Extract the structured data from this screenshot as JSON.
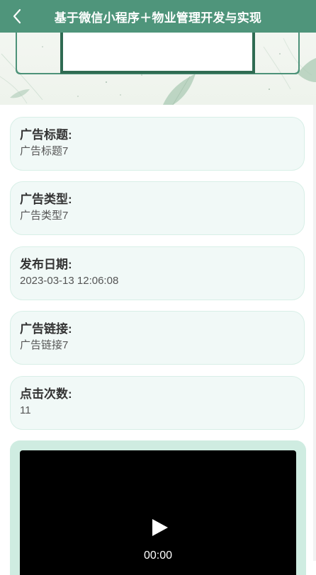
{
  "navbar": {
    "title": "基于微信小程序＋物业管理开发与实现",
    "back_icon": "chevron-left-icon",
    "background": "#4f957b"
  },
  "fields": [
    {
      "label": "广告标题:",
      "value": "广告标题7"
    },
    {
      "label": "广告类型:",
      "value": "广告类型7"
    },
    {
      "label": "发布日期:",
      "value": "2023-03-13 12:06:08"
    },
    {
      "label": "广告链接:",
      "value": "广告链接7"
    },
    {
      "label": "点击次数:",
      "value": "11"
    }
  ],
  "video": {
    "time": "00:00",
    "play_icon": "play-icon"
  },
  "colors": {
    "card_bg": "#f1f9f7",
    "card_border": "#d8efe7",
    "video_frame": "#cfece1",
    "accent": "#4f957b"
  }
}
